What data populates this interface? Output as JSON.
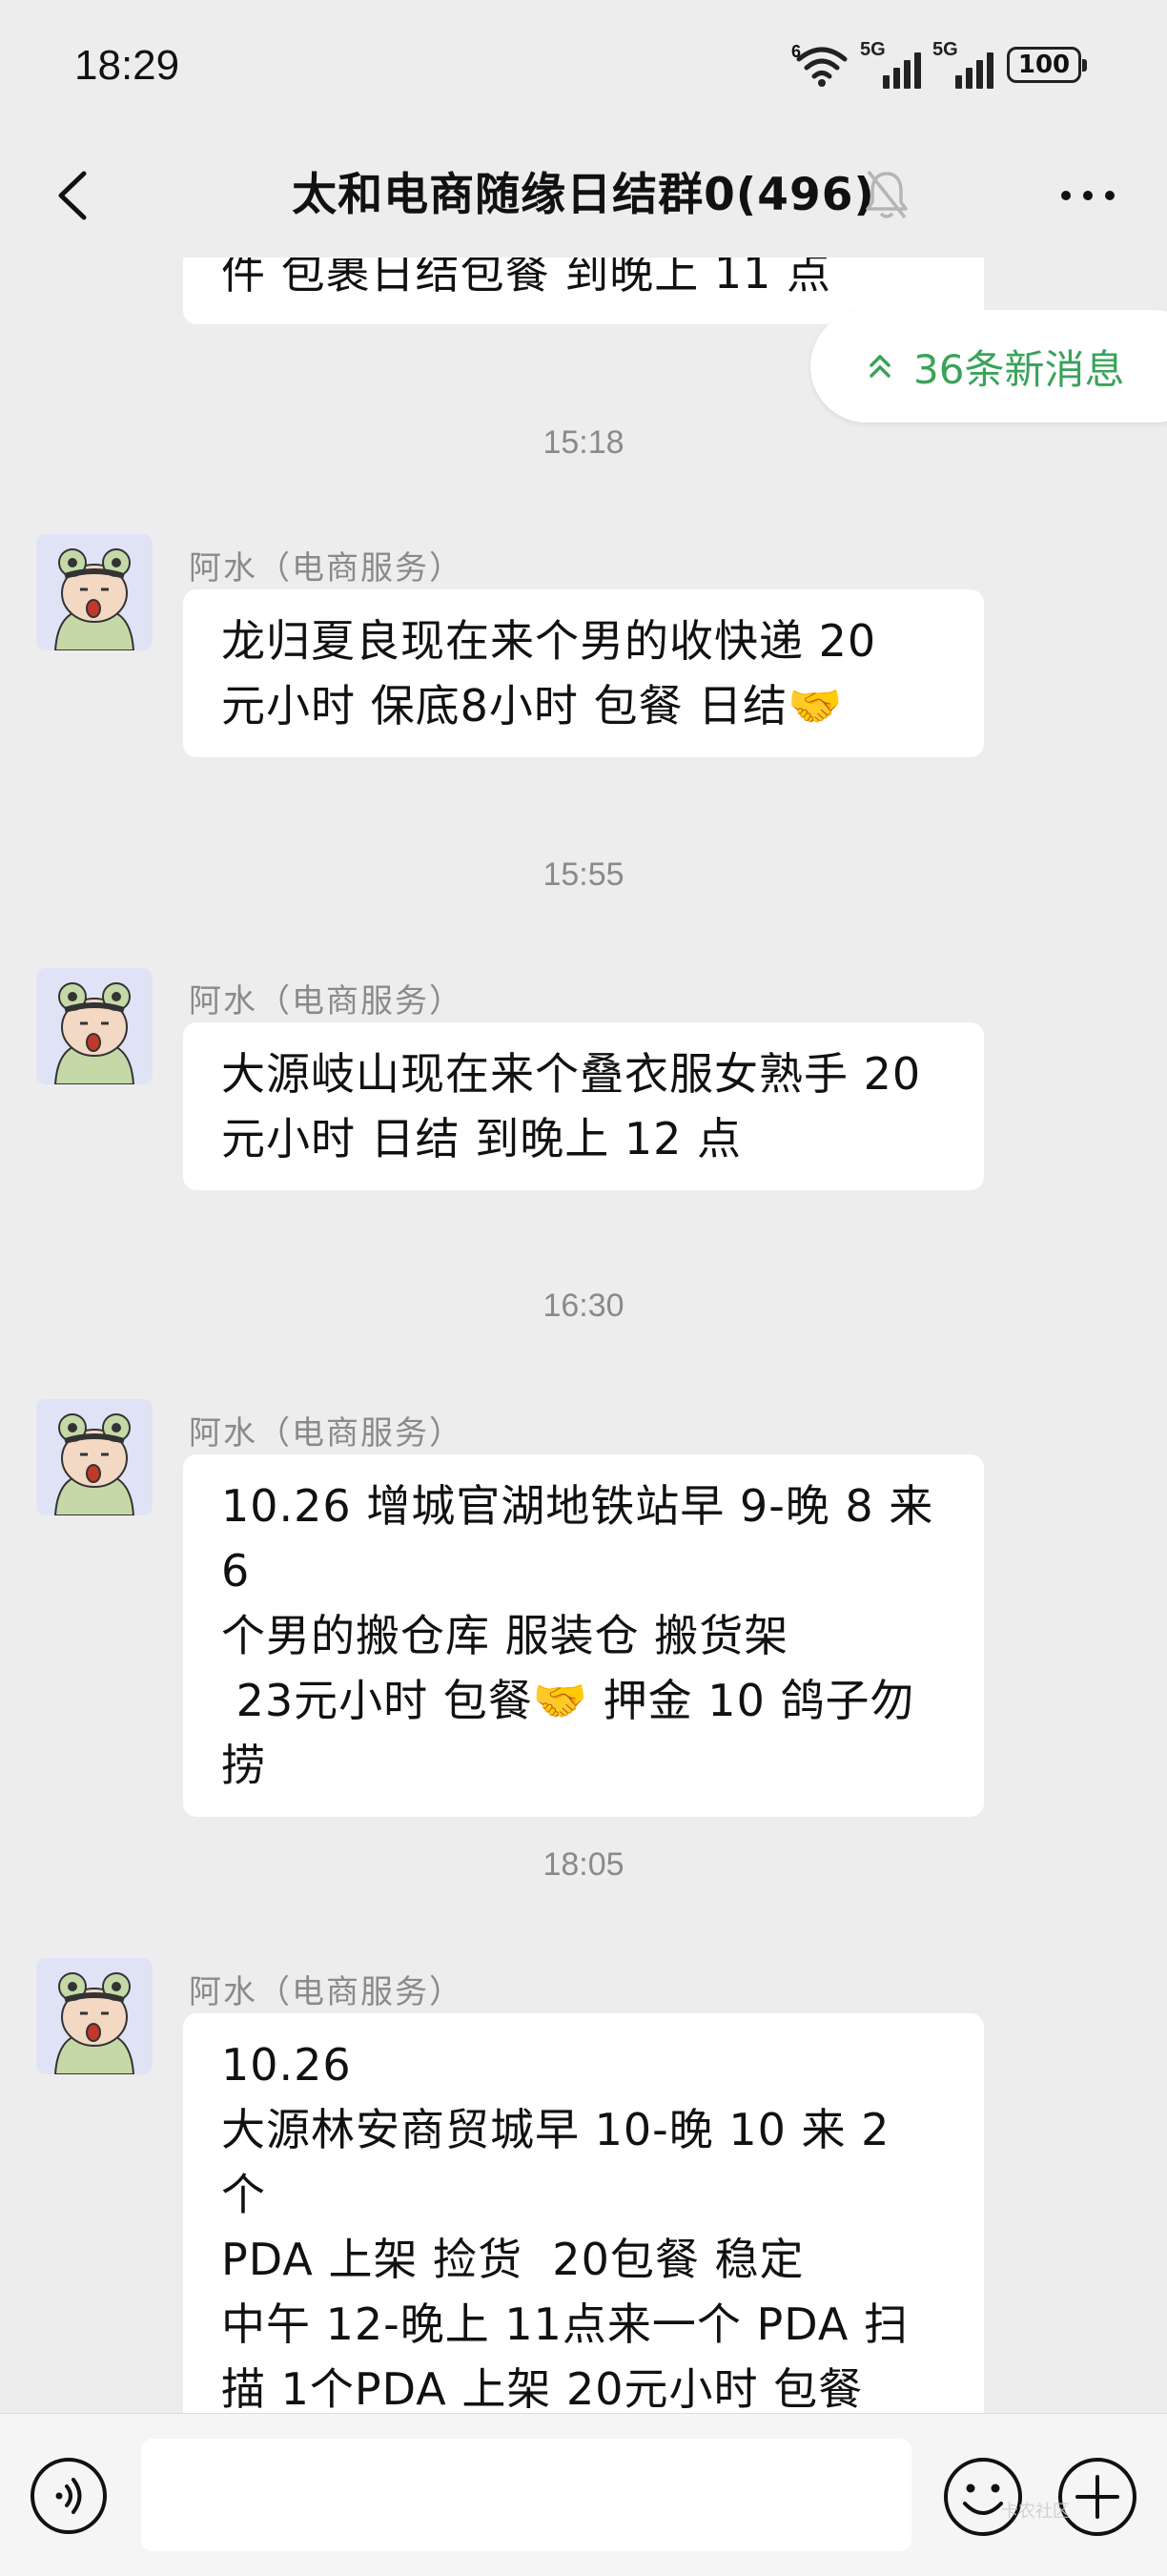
{
  "status_bar": {
    "time": "18:29",
    "wifi_tag": "6",
    "sim1_tag": "5G",
    "sim2_tag": "5G",
    "battery": "100"
  },
  "nav": {
    "title": "太和电商随缘日结群0(496)",
    "back_icon": "chevron-left-icon",
    "mute_icon": "bell-off-icon",
    "more_icon": "more-dots-icon"
  },
  "chat": {
    "partial_message": "件 包裹日结包餐 到晚上 11 点",
    "new_messages_pill": "36条新消息",
    "messages": [
      {
        "timestamp": "15:18",
        "sender": "阿水（电商服务）",
        "text": "龙归夏良现在来个男的收快递 20\n元小时 保底8小时 包餐 日结🤝"
      },
      {
        "timestamp": "15:55",
        "sender": "阿水（电商服务）",
        "text": "大源岐山现在来个叠衣服女熟手 20\n元小时 日结 到晚上 12 点"
      },
      {
        "timestamp": "16:30",
        "sender": "阿水（电商服务）",
        "text": "10.26 增城官湖地铁站早 9-晚 8 来 6\n个男的搬仓库 服装仓 搬货架\n 23元小时 包餐🤝 押金 10 鸽子勿\n捞"
      },
      {
        "timestamp": "18:05",
        "sender": "阿水（电商服务）",
        "text": "10.26\n大源林安商贸城早 10-晚 10 来 2 个\nPDA 上架 捡货  20包餐 稳定\n中午 12-晚上 11点来一个 PDA 扫\n描 1个PDA 上架 20元小时 包餐"
      }
    ]
  },
  "input_bar": {
    "text_value": "",
    "voice_icon": "voice-icon",
    "emoji_icon": "emoji-icon",
    "plus_icon": "plus-circle-icon"
  },
  "watermark": "卡农社区",
  "colors": {
    "background": "#ededed",
    "bubble": "#ffffff",
    "accent_green": "#3aa35a",
    "meta_gray": "#8a8a8a"
  }
}
